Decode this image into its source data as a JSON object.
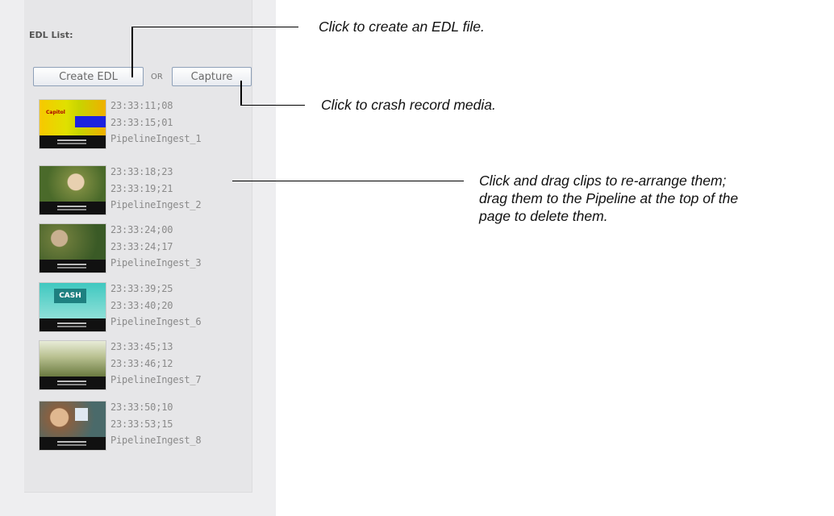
{
  "panel": {
    "title": "EDL List:",
    "create_label": "Create EDL",
    "or_label": "OR",
    "capture_label": "Capture"
  },
  "clips": [
    {
      "in": "23:33:11;08",
      "out": "23:33:15;01",
      "name": "PipelineIngest_1",
      "thumb": "studio-graphic"
    },
    {
      "in": "23:33:18;23",
      "out": "23:33:19;21",
      "name": "PipelineIngest_2",
      "thumb": "woman-outdoors"
    },
    {
      "in": "23:33:24;00",
      "out": "23:33:24;17",
      "name": "PipelineIngest_3",
      "thumb": "man-outdoors"
    },
    {
      "in": "23:33:39;25",
      "out": "23:33:40;20",
      "name": "PipelineIngest_6",
      "thumb": "cash-graphic"
    },
    {
      "in": "23:33:45;13",
      "out": "23:33:46;12",
      "name": "PipelineIngest_7",
      "thumb": "field-scene"
    },
    {
      "in": "23:33:50;10",
      "out": "23:33:53;15",
      "name": "PipelineIngest_8",
      "thumb": "woman-talking"
    }
  ],
  "callouts": {
    "create": "Click to create an EDL file.",
    "capture": "Click to crash record media.",
    "drag_line1": "Click and drag clips to re-arrange them;",
    "drag_line2": "drag them to the Pipeline at the top of the",
    "drag_line3": "page to delete them."
  }
}
